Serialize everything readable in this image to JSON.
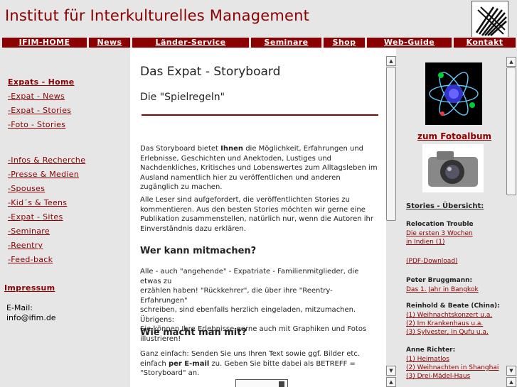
{
  "header": {
    "site_title": "Institut für Interkulturelles Management"
  },
  "nav": [
    "IFIM-HOME",
    "News",
    "Länder-Service",
    "Seminare",
    "Shop",
    "Web-Guide",
    "Kontakt"
  ],
  "sidebar": {
    "group1": [
      "Expats - Home",
      "-Expat - News",
      "-Expat - Stories",
      "-Foto - Stories"
    ],
    "group2": [
      "-Infos & Recherche",
      "-Presse & Medien",
      "-Spouses",
      "-Kid´s & Teens",
      "-Expat - Sites",
      "-Seminare",
      "-Reentry",
      "-Feed-back"
    ],
    "impressum": "Impressum",
    "email_label": "E-Mail:",
    "email": "info@ifim.de"
  },
  "main": {
    "title": "Das Expat - Storyboard",
    "subtitle": "Die \"Spielregeln\"",
    "p1_a": "Das Storyboard bietet ",
    "p1_bold": "Ihnen",
    "p1_b": " die Möglichkeit, Erfahrungen und Erlebnisse, Geschichten und Anektoden, Lustiges und Nachdenkliches, Kritisches und Lobenswertes  zum Alltagsleben im Ausland namentlich hier zu veröffentlichen und anderen zugänglich zu machen.",
    "p2": "Alle Leser sind aufgefordert, die veröffentlichten Stories zu kommentieren. Aus den besten Stories möchten wir gerne eine Publikation zusammenstellen, natürlich nur, wenn die Autoren ihr Einverständnis dazu erklären.",
    "h1": "Wer kann mitmachen?",
    "p3_l1": "Alle - auch \"angehende\" -  Expatriate - Familienmitglieder, die etwas zu",
    "p3_l2": "erzählen haben!  \"Rückkehrer\", die über ihre \"Reentry-Erfahrungen\"",
    "p3_l3": "schreiben, sind ebenfalls herzlich eingeladen, mitzumachen.",
    "p3_l4": "Übrigens:",
    "p3_l5": "Sie können Ihre Erlebnisse gerne auch mit Graphiken und Fotos illustrieren!",
    "h2": "Wie macht man mit?",
    "p4_a": "Ganz einfach: Senden Sie uns Ihren Text sowie ggf. Bilder etc. einfach ",
    "p4_bold": "per E-mail",
    "p4_b": " zu. Geben Sie bitte dabei als BETREFF = \"Storyboard\" an."
  },
  "right": {
    "album_link": "zum Fotoalbum",
    "stories_heading": "Stories - Übersicht:",
    "entries": [
      {
        "type": "head",
        "text": "Relocation Trouble"
      },
      {
        "type": "link",
        "text": "Die ersten 3 Wochen"
      },
      {
        "type": "link",
        "text": "in Indien (1)"
      },
      {
        "type": "link",
        "text": "(PDF-Download)"
      },
      {
        "type": "head",
        "text": "Peter Bruggmann:"
      },
      {
        "type": "link",
        "text": "Das 1. Jahr in Bangkok"
      },
      {
        "type": "head",
        "text": "Reinhold & Beate (China):"
      },
      {
        "type": "link",
        "text": "(1) Weihnachtskonzert u.a."
      },
      {
        "type": "link",
        "text": "(2) Im Krankenhaus u.a."
      },
      {
        "type": "link",
        "text": "(3) Sylvester, In Qufu u.a."
      },
      {
        "type": "head",
        "text": "Anne Richter:"
      },
      {
        "type": "link",
        "text": "(1) Heimatlos"
      },
      {
        "type": "link",
        "text": "(2) Weihnachten in Shanghai"
      },
      {
        "type": "link",
        "text": "(3) Drei-Mädel-Haus"
      }
    ]
  },
  "colors": {
    "brand": "#8b0000",
    "panel": "#e6e6e6"
  }
}
